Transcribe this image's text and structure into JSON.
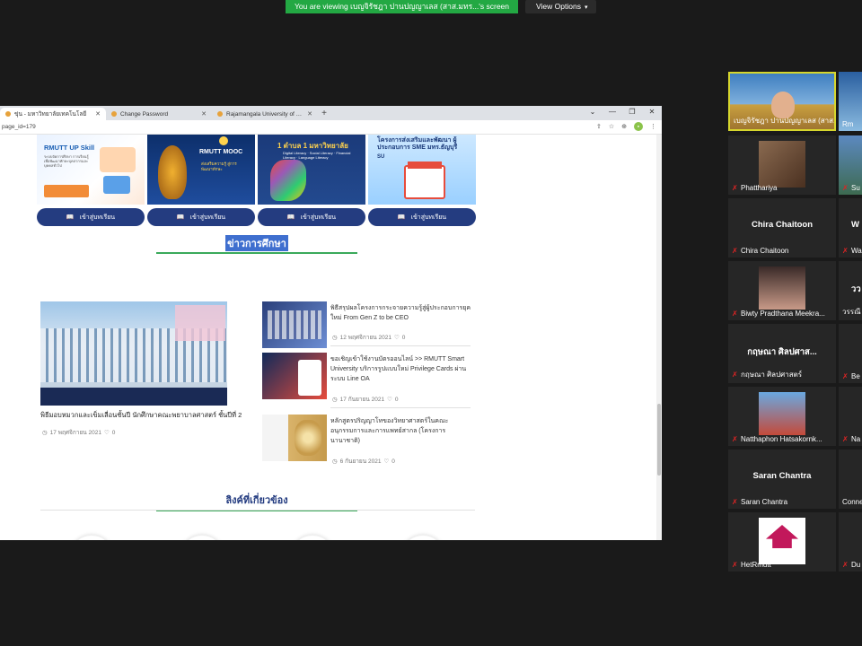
{
  "banner": {
    "message": "You are viewing เบญจิรัชฎา ปานปญญาเลส (สาส.มทร...'s screen",
    "view_options": "View Options"
  },
  "browser": {
    "tabs": [
      {
        "title": "ขุ่น - มหาวิทยาลัยเทคโนโลยี",
        "active": true
      },
      {
        "title": "Change Password",
        "active": false
      },
      {
        "title": "Rajamangala University of Techn",
        "active": false
      }
    ],
    "address": "page_id=179"
  },
  "courses": [
    {
      "title": "RMUTT UP Skill",
      "subtitle": "ระบบจัดการศึกษา การเรียนรู้เพื่อพัฒนาทักษะบุคลากรและบุคคลทั่วไป",
      "button": "เข้าสู่บทเรียน",
      "color": "#e9f2ff"
    },
    {
      "title": "RMUTT MOOC",
      "subtitle": "ส่งเสริมความรู้ สู่การพัฒนาทักษะ",
      "button": "เข้าสู่บทเรียน",
      "color": "#0d2f6b"
    },
    {
      "title": "1 ตำบล 1 มหาวิทยาลัย",
      "subtitle": "Digital Literacy · Social Literacy · Financial Literacy · Language Literacy",
      "button": "เข้าสู่บทเรียน",
      "color": "#1b3a7a"
    },
    {
      "title": "โครงการส่งเสริมและพัฒนา ผู้ประกอบการ SME มทร.ธัญบุรี",
      "subtitle": "SU",
      "button": "เข้าสู่บทเรียน",
      "color": "#cde8ff"
    }
  ],
  "news": {
    "heading": "ข่าวการศึกษา",
    "main": {
      "title": "พิธีมอบหมวกและเข็มเลื่อนชั้นปี นักศึกษาคณะพยาบาลศาสตร์ ชั้นปีที่ 2",
      "date": "17 พฤศจิกายน 2021",
      "likes": "0"
    },
    "items": [
      {
        "title": "พิธีสรุปผลโครงการกระจายความรู้สู่ผู้ประกอบการยุคใหม่ From Gen Z to be CEO",
        "date": "12 พฤศจิกายน 2021",
        "likes": "0"
      },
      {
        "title": "ขอเชิญเข้าใช้งานบัตรออนไลน์ >> RMUTT Smart University บริการรูปแบบใหม่ Privilege Cards ผ่านระบบ Line OA",
        "date": "17 กันยายน 2021",
        "likes": "0"
      },
      {
        "title": "หลักสูตรปริญญาโทของวิทยาศาสตร์ในคณะอนุกรรมการและการแพทย์สากล (โครงการนานาชาติ)",
        "date": "6 กันยายน 2021",
        "likes": "0"
      }
    ]
  },
  "related": {
    "heading": "ลิงค์ที่เกี่ยวข้อง",
    "icons": [
      "book-icon",
      "windows-icon",
      "user-icon",
      "home-icon"
    ]
  },
  "participants": [
    {
      "name": "เบญจิรัชฎา ปานปญญาเลส (สาส.ม...",
      "type": "video",
      "active": true
    },
    {
      "name": "Phatthariya",
      "type": "video"
    },
    {
      "name": "Chira Chaitoon",
      "display": "Chira Chaitoon",
      "type": "name"
    },
    {
      "name": "Biwty Pradthana Meekra...",
      "type": "video"
    },
    {
      "name": "กฤษณา ศิลปศาสตร์",
      "display": "กฤษณา ศิลปศาส...",
      "type": "name"
    },
    {
      "name": "Natthaphon Hatsakornk...",
      "type": "video"
    },
    {
      "name": "Saran Chantra",
      "display": "Saran Chantra",
      "type": "name"
    },
    {
      "name": "HetRmutt",
      "type": "logo"
    }
  ],
  "participants_col2": [
    {
      "name": "Rm"
    },
    {
      "name": "Su"
    },
    {
      "name": "Wa",
      "display": "W"
    },
    {
      "name": "วรรณี",
      "display": "วว"
    },
    {
      "name": "Be"
    },
    {
      "name": "Na"
    },
    {
      "name": "Conne"
    },
    {
      "name": "Du"
    }
  ]
}
